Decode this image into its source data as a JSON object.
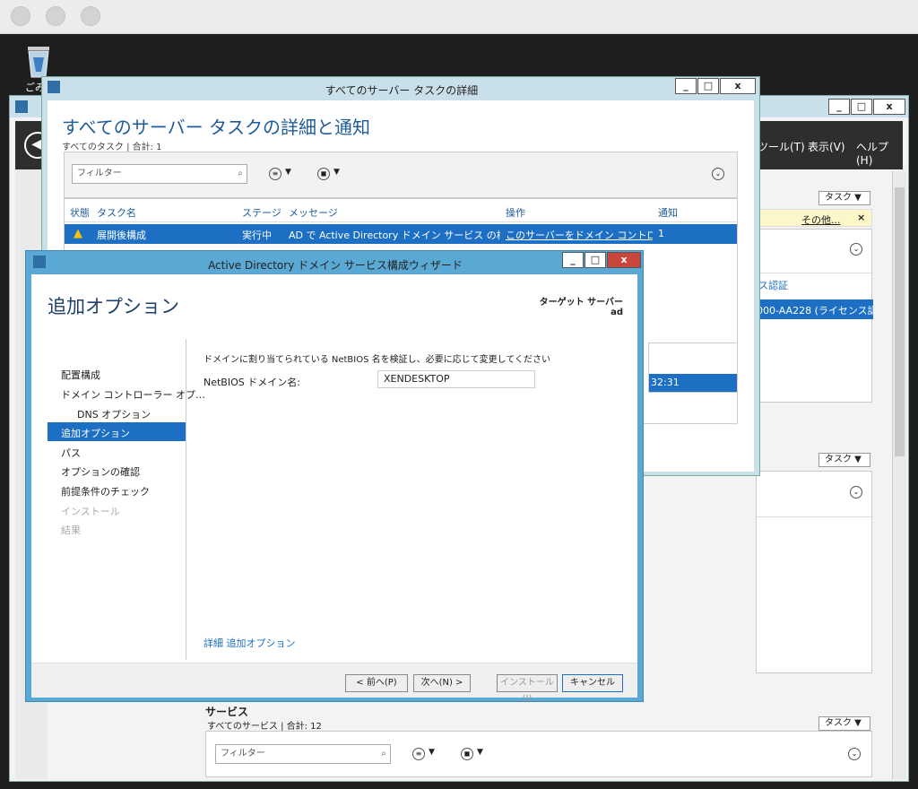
{
  "mac": {
    "buttons": [
      "close",
      "minimize",
      "zoom"
    ]
  },
  "desktop": {
    "recycle_label": "ごみ"
  },
  "server_manager": {
    "menu": {
      "tools": "ツール(T)",
      "view": "表示(V)",
      "help": "ヘルプ(H)"
    },
    "task_label": "タスク",
    "notice_more": "その他...",
    "license_text": "ス認証",
    "license_value": "000-AA228 (ライセンス認証",
    "time_text": "32:31",
    "services": {
      "title": "サービス",
      "subtitle": "すべてのサービス | 合計: 12",
      "filter_placeholder": "フィルター"
    },
    "controls": {
      "minimize": "_",
      "maximize": "□",
      "close": "x"
    }
  },
  "task_details": {
    "window_title": "すべてのサーバー タスクの詳細",
    "heading": "すべてのサーバー タスクの詳細と通知",
    "subheading": "すべてのタスク | 合計: 1",
    "filter_placeholder": "フィルター",
    "columns": [
      "状態",
      "タスク名",
      "ステージ",
      "メッセージ",
      "操作",
      "通知"
    ],
    "row": {
      "task": "展開後構成",
      "stage": "実行中",
      "message": "AD で Active Directory ドメイン サービス の構成…",
      "action": "このサーバーをドメイン コントローラー…",
      "notify": "1"
    }
  },
  "wizard": {
    "window_title": "Active Directory ドメイン サービス構成ウィザード",
    "heading": "追加オプション",
    "target_label": "ターゲット サーバー",
    "target_value": "ad",
    "nav": [
      "配置構成",
      "ドメイン コントローラー オプ…",
      "DNS オプション",
      "追加オプション",
      "パス",
      "オプションの確認",
      "前提条件のチェック",
      "インストール",
      "結果"
    ],
    "instruction": "ドメインに割り当てられている NetBIOS 名を検証し、必要に応じて変更してください",
    "netbios_label": "NetBIOS ドメイン名:",
    "netbios_value": "XENDESKTOP",
    "more_link": "詳細 追加オプション",
    "buttons": {
      "prev": "< 前へ(P)",
      "next": "次へ(N) >",
      "install": "インストール(I)",
      "cancel": "キャンセル"
    }
  },
  "colors": {
    "accent": "#1d6fc4",
    "wizard_frame": "#5aa9d4",
    "heading": "#1e5b9a"
  }
}
